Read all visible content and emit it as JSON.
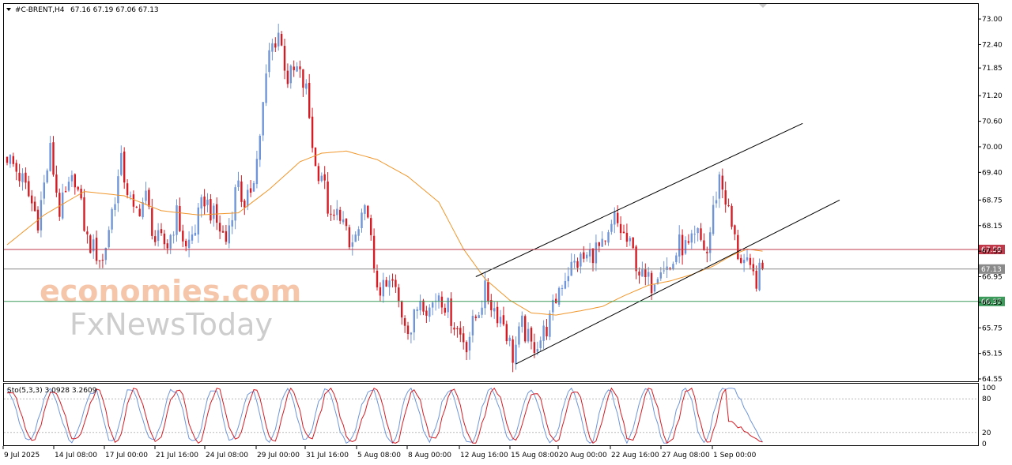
{
  "header": {
    "symbol": "#C-BRENT,H4",
    "ohlc": "67.16 67.19 67.06 67.13"
  },
  "watermark": {
    "line1": "economies.com",
    "line2": "FxNewsToday"
  },
  "colors": {
    "bull": "#6f95d8",
    "bear": "#d41c24",
    "ma": "#f0962b",
    "resistance": "#c0394a",
    "support": "#3c9a5a",
    "current": "#8a8a8a",
    "stoch_main": "#6f95d8",
    "stoch_signal": "#d41c24",
    "watermark_orange": "#f6c0a3",
    "watermark_gray": "#c8c8c8"
  },
  "chart_data": [
    {
      "type": "candlestick",
      "symbol": "#C-BRENT",
      "timeframe": "H4",
      "ylim": [
        64.55,
        73.15
      ],
      "y_ticks": [
        "73.00",
        "72.40",
        "71.85",
        "71.20",
        "70.60",
        "70.00",
        "69.40",
        "68.75",
        "68.15",
        "67.55",
        "66.95",
        "66.35",
        "65.75",
        "65.15",
        "64.55"
      ],
      "x_labels": [
        "9 Jul 2025",
        "14 Jul 08:00",
        "17 Jul 00:00",
        "21 Jul 16:00",
        "24 Jul 08:00",
        "29 Jul 00:00",
        "31 Jul 16:00",
        "5 Aug 08:00",
        "8 Aug 00:00",
        "12 Aug 16:00",
        "15 Aug 08:00",
        "20 Aug 00:00",
        "22 Aug 16:00",
        "27 Aug 08:00",
        "1 Sep 00:00"
      ],
      "close_path": [
        [
          0,
          69.8
        ],
        [
          5,
          69.2
        ],
        [
          10,
          68.3
        ],
        [
          14,
          69.9
        ],
        [
          17,
          68.5
        ],
        [
          22,
          69.3
        ],
        [
          26,
          67.8
        ],
        [
          31,
          67.3
        ],
        [
          34,
          68.5
        ],
        [
          37,
          69.6
        ],
        [
          41,
          68.4
        ],
        [
          45,
          68.8
        ],
        [
          48,
          67.8
        ],
        [
          52,
          67.7
        ],
        [
          55,
          68.4
        ],
        [
          58,
          67.6
        ],
        [
          61,
          68.1
        ],
        [
          64,
          68.8
        ],
        [
          68,
          68.2
        ],
        [
          71,
          67.8
        ],
        [
          75,
          69.3
        ],
        [
          77,
          68.4
        ],
        [
          81,
          69.7
        ],
        [
          85,
          72.2
        ],
        [
          88,
          72.7
        ],
        [
          91,
          71.6
        ],
        [
          94,
          71.8
        ],
        [
          97,
          71.3
        ],
        [
          100,
          69.5
        ],
        [
          102,
          69.4
        ],
        [
          105,
          68.2
        ],
        [
          108,
          68.5
        ],
        [
          111,
          67.6
        ],
        [
          114,
          68.0
        ],
        [
          117,
          68.6
        ],
        [
          119,
          66.9
        ],
        [
          122,
          66.6
        ],
        [
          125,
          66.8
        ],
        [
          128,
          66.1
        ],
        [
          131,
          65.7
        ],
        [
          134,
          66.5
        ],
        [
          137,
          66.2
        ],
        [
          140,
          66.6
        ],
        [
          143,
          66.2
        ],
        [
          146,
          65.7
        ],
        [
          149,
          65.4
        ],
        [
          152,
          66.0
        ],
        [
          155,
          66.6
        ],
        [
          158,
          66.2
        ],
        [
          161,
          65.9
        ],
        [
          164,
          65.1
        ],
        [
          167,
          65.8
        ],
        [
          170,
          65.3
        ],
        [
          173,
          65.5
        ],
        [
          176,
          65.9
        ],
        [
          179,
          66.7
        ],
        [
          182,
          67.1
        ],
        [
          185,
          67.3
        ],
        [
          188,
          67.4
        ],
        [
          191,
          67.6
        ],
        [
          194,
          67.6
        ],
        [
          197,
          68.3
        ],
        [
          200,
          67.9
        ],
        [
          203,
          67.5
        ],
        [
          206,
          66.9
        ],
        [
          209,
          66.8
        ],
        [
          212,
          67.3
        ],
        [
          215,
          67.1
        ],
        [
          218,
          67.7
        ],
        [
          221,
          67.6
        ],
        [
          224,
          67.9
        ],
        [
          227,
          67.5
        ],
        [
          229,
          68.5
        ],
        [
          231,
          69.3
        ],
        [
          233,
          68.8
        ],
        [
          235,
          68.1
        ],
        [
          237,
          67.5
        ],
        [
          239,
          67.3
        ],
        [
          241,
          67.0
        ],
        [
          243,
          66.9
        ],
        [
          245,
          67.13
        ]
      ],
      "ma_path": [
        [
          0,
          67.7
        ],
        [
          12,
          68.4
        ],
        [
          25,
          68.95
        ],
        [
          38,
          68.85
        ],
        [
          50,
          68.5
        ],
        [
          62,
          68.4
        ],
        [
          75,
          68.45
        ],
        [
          85,
          69.0
        ],
        [
          95,
          69.65
        ],
        [
          102,
          69.85
        ],
        [
          110,
          69.9
        ],
        [
          120,
          69.7
        ],
        [
          130,
          69.3
        ],
        [
          140,
          68.7
        ],
        [
          148,
          67.6
        ],
        [
          155,
          66.9
        ],
        [
          163,
          66.4
        ],
        [
          170,
          66.1
        ],
        [
          178,
          66.05
        ],
        [
          186,
          66.15
        ],
        [
          193,
          66.25
        ],
        [
          200,
          66.5
        ],
        [
          208,
          66.75
        ],
        [
          215,
          66.85
        ],
        [
          222,
          67.0
        ],
        [
          229,
          67.2
        ],
        [
          235,
          67.45
        ],
        [
          240,
          67.6
        ],
        [
          245,
          67.55
        ]
      ],
      "channel_upper": [
        [
          152,
          66.95
        ],
        [
          258,
          70.55
        ]
      ],
      "channel_lower": [
        [
          165,
          64.9
        ],
        [
          270,
          68.75
        ]
      ],
      "levels": [
        {
          "label": "67.59",
          "price": 67.59,
          "role": "resistance"
        },
        {
          "label": "67.13",
          "price": 67.13,
          "role": "current"
        },
        {
          "label": "66.37",
          "price": 66.37,
          "role": "support"
        }
      ]
    },
    {
      "type": "line",
      "title": "Sto(5,3,3) 3.0928 3.2609",
      "ylim": [
        0,
        100
      ],
      "y_ticks": [
        "100",
        "80",
        "20",
        "0"
      ],
      "levels": [
        80,
        20
      ],
      "cycle_peaks": [
        0,
        14,
        28,
        40,
        54,
        67,
        79,
        91,
        103,
        118,
        131,
        143,
        157,
        170,
        183,
        195,
        207,
        220,
        232
      ],
      "last_values": {
        "main": 3.0928,
        "signal": 3.2609
      }
    }
  ]
}
